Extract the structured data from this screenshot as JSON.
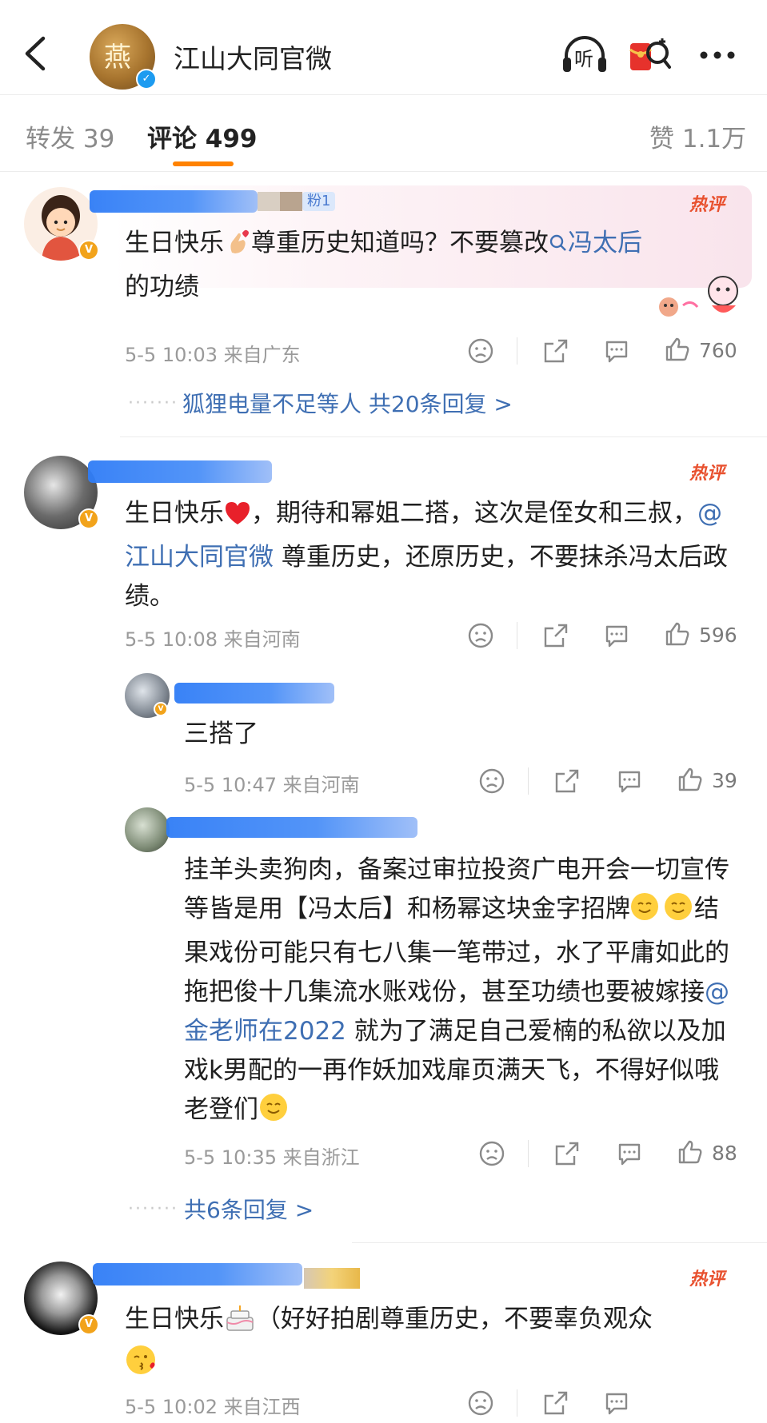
{
  "header": {
    "title": "江山大同官微",
    "avatar_glyph": "燕",
    "listen_label": "听"
  },
  "tabs": [
    {
      "label": "转发 39"
    },
    {
      "label": "评论 499"
    },
    {
      "label": "赞 1.1万"
    }
  ],
  "hot_label": "热评",
  "comments": [
    {
      "name_fragment": "粉1",
      "text_parts": [
        "生日快乐",
        "尊重历史知道吗？不要篡改",
        "冯太后",
        "的功绩"
      ],
      "time": "5-5 10:03",
      "location": "来自广东",
      "likes": "760",
      "reply_preview": "狐狸电量不足等人 共20条回复 >"
    },
    {
      "text_parts": [
        "生日快乐",
        "，期待和幂姐二搭，这次是侄女和三叔，",
        "@江山大同官微",
        " 尊重历史，还原历史，不要抹杀冯太后政绩。"
      ],
      "time": "5-5 10:08",
      "location": "来自河南",
      "likes": "596",
      "sub_replies": [
        {
          "text": "三搭了",
          "time": "5-5 10:47",
          "location": "来自河南",
          "likes": "39"
        },
        {
          "text_parts": [
            "挂羊头卖狗肉，备案过审拉投资广电开会一切宣传等皆是用【冯太后】和杨幂这块金字招牌",
            "结果戏份可能只有七八集一笔带过，水了平庸如此的拖把俊十几集流水账戏份，甚至功绩也要被嫁接",
            "@金老师在2022",
            " 就为了满足自己爱楠的私欲以及加戏k男配的一再作妖加戏扉页满天飞，不得好似哦老登们"
          ],
          "time": "5-5 10:35",
          "location": "来自浙江",
          "likes": "88"
        }
      ],
      "reply_total": "共6条回复 >"
    },
    {
      "text_parts": [
        "生日快乐",
        "（好好拍剧尊重历史，不要辜负观众"
      ],
      "time": "5-5 10:02",
      "location": "来自江西"
    }
  ],
  "colors": {
    "accent": "#ff8200",
    "link": "#3f6fb3",
    "hot": "#e8512f",
    "verified_blue": "#1d9bf0",
    "verified_gold": "#f2a31b"
  }
}
